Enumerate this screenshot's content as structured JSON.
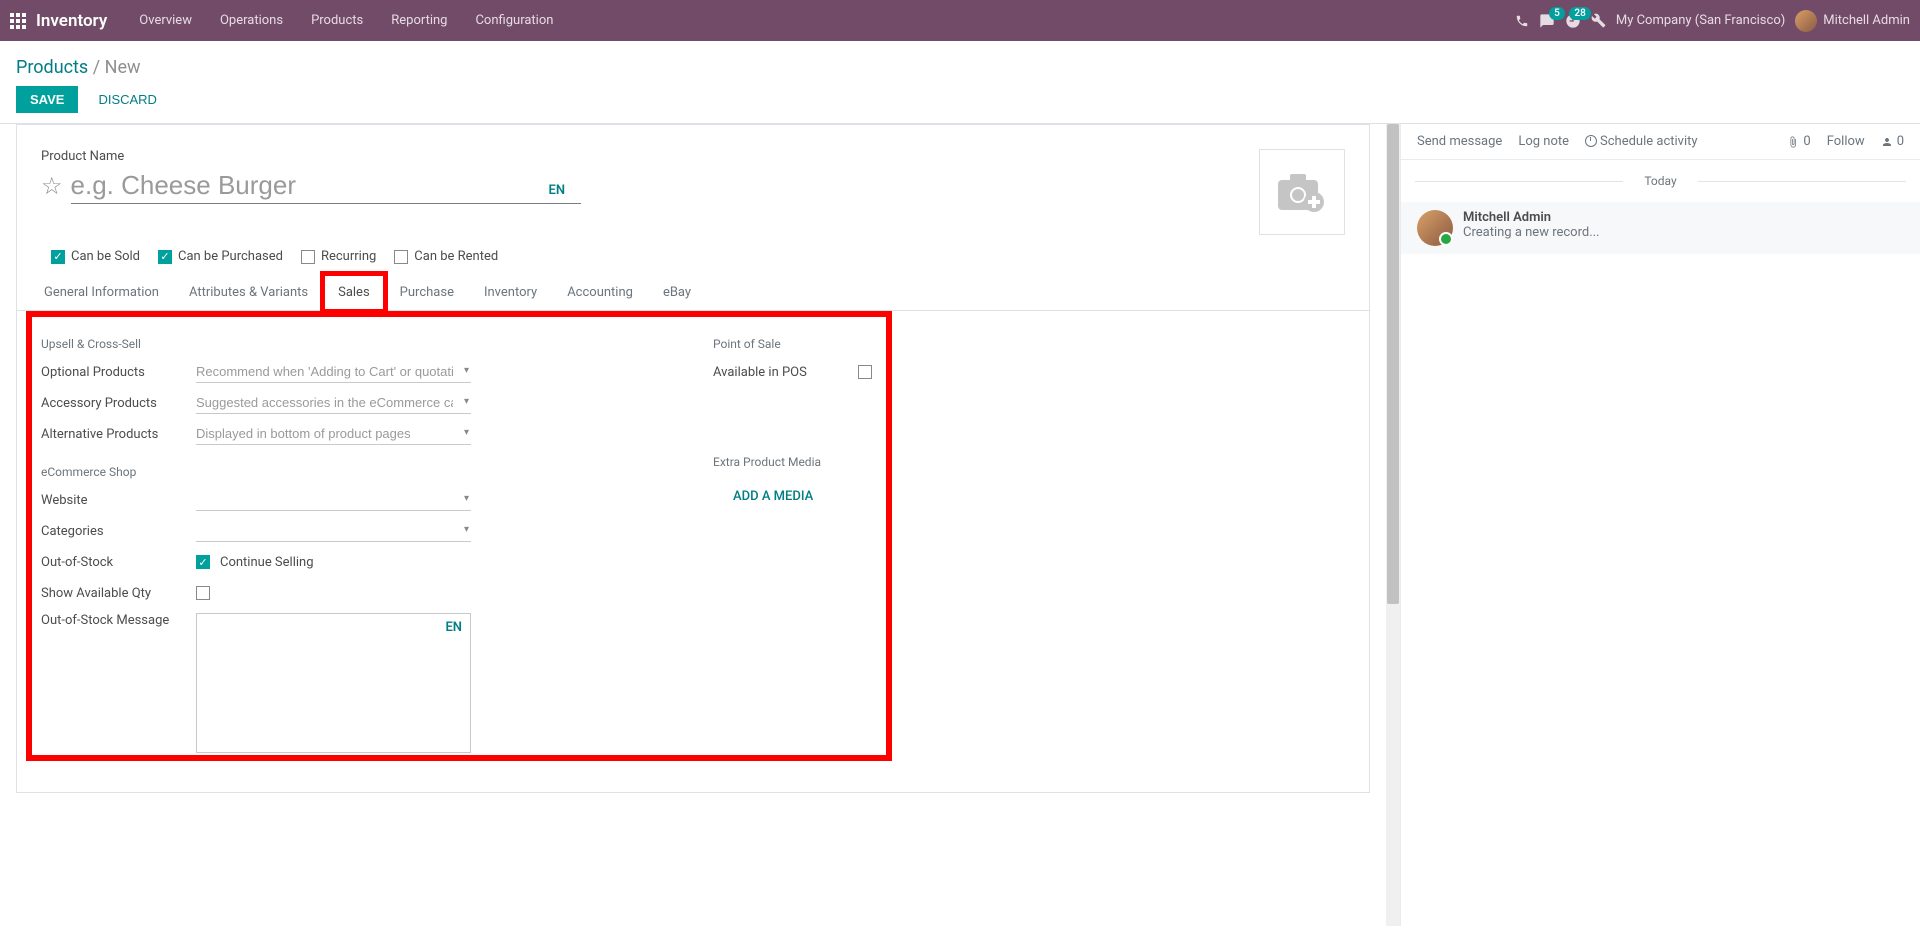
{
  "topnav": {
    "brand": "Inventory",
    "menu": [
      "Overview",
      "Operations",
      "Products",
      "Reporting",
      "Configuration"
    ],
    "messages_badge": "5",
    "activities_badge": "28",
    "company": "My Company (San Francisco)",
    "user": "Mitchell Admin"
  },
  "breadcrumb": {
    "parent": "Products",
    "current": "New"
  },
  "actions": {
    "save": "SAVE",
    "discard": "DISCARD"
  },
  "form": {
    "product_name_label": "Product Name",
    "product_name_placeholder": "e.g. Cheese Burger",
    "lang": "EN",
    "checks": {
      "can_be_sold": {
        "label": "Can be Sold",
        "checked": true
      },
      "can_be_purchased": {
        "label": "Can be Purchased",
        "checked": true
      },
      "recurring": {
        "label": "Recurring",
        "checked": false
      },
      "can_be_rented": {
        "label": "Can be Rented",
        "checked": false
      }
    },
    "tabs": [
      "General Information",
      "Attributes & Variants",
      "Sales",
      "Purchase",
      "Inventory",
      "Accounting",
      "eBay"
    ],
    "active_tab": "Sales"
  },
  "sales_tab": {
    "upsell_title": "Upsell & Cross-Sell",
    "optional_label": "Optional Products",
    "optional_placeholder": "Recommend when 'Adding to Cart' or quotation",
    "accessory_label": "Accessory Products",
    "accessory_placeholder": "Suggested accessories in the eCommerce cart",
    "alternative_label": "Alternative Products",
    "alternative_placeholder": "Displayed in bottom of product pages",
    "ecom_title": "eCommerce Shop",
    "website_label": "Website",
    "categories_label": "Categories",
    "oos_label": "Out-of-Stock",
    "oos_continue": "Continue Selling",
    "oos_continue_checked": true,
    "show_qty_label": "Show Available Qty",
    "show_qty_checked": false,
    "oos_msg_label": "Out-of-Stock Message",
    "oos_msg_lang": "EN",
    "pos_title": "Point of Sale",
    "available_pos_label": "Available in POS",
    "available_pos_checked": false,
    "extra_media_title": "Extra Product Media",
    "add_media": "ADD A MEDIA"
  },
  "chat": {
    "send": "Send message",
    "log": "Log note",
    "schedule": "Schedule activity",
    "attach_count": "0",
    "follow": "Follow",
    "followers": "0",
    "today": "Today",
    "msg_name": "Mitchell Admin",
    "msg_text": "Creating a new record..."
  }
}
